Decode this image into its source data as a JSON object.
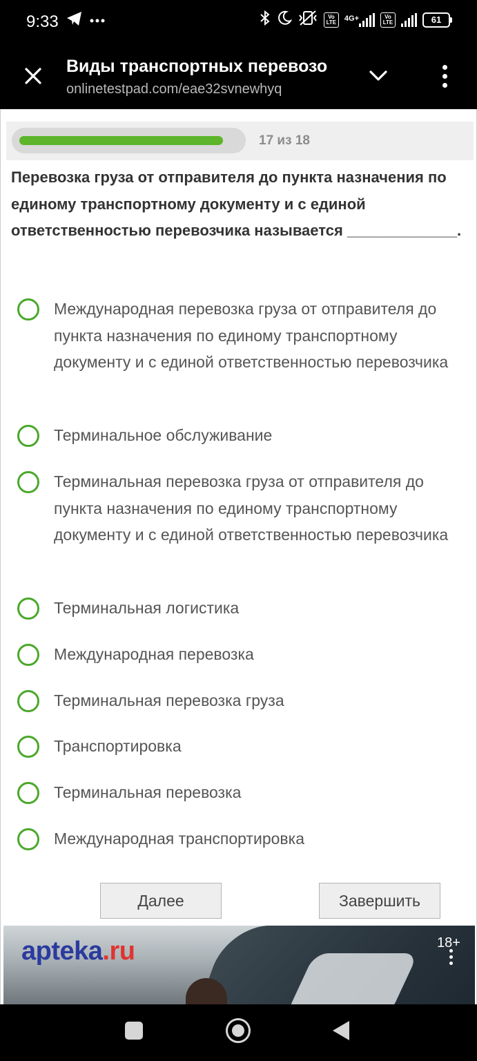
{
  "status_bar": {
    "time": "9:33",
    "telegram_icon": "telegram-icon",
    "more_icon": "more-dots-icon",
    "network_tag": "4G+",
    "volte": "VoLTE",
    "battery_level": "61"
  },
  "browser": {
    "title": "Виды транспортных перевозо",
    "url": "onlinetestpad.com/eae32svnewhyq",
    "close_icon": "close-icon",
    "chevron_icon": "chevron-down-icon",
    "menu_icon": "more-vert-icon"
  },
  "quiz": {
    "progress_text": "17 из 18",
    "progress_current": 17,
    "progress_total": 18,
    "progress_color": "#5cb52a",
    "question": "Перевозка груза от отправителя до пункта назначения по единому транспортному документу и с единой ответственностью перевозчика называется _____________.",
    "options": [
      "Международная перевозка груза от отправителя до пункта назначения по единому транспортному документу и с единой ответственностью перевозчика",
      "Терминальное обслуживание",
      "Терминальная перевозка груза от отправителя до пункта назначения по единому транспортному документу и с единой ответственностью перевозчика",
      "Терминальная логистика",
      "Международная перевозка",
      "Терминальная перевозка груза",
      "Транспортировка",
      "Терминальная перевозка",
      "Международная транспортировка"
    ],
    "next_label": "Далее",
    "finish_label": "Завершить"
  },
  "ad": {
    "logo_main": "apteka",
    "logo_suffix": ".ru",
    "age_label": "18+"
  },
  "navbar": {
    "recents_icon": "recents-icon",
    "home_icon": "home-icon",
    "back_icon": "back-icon"
  }
}
